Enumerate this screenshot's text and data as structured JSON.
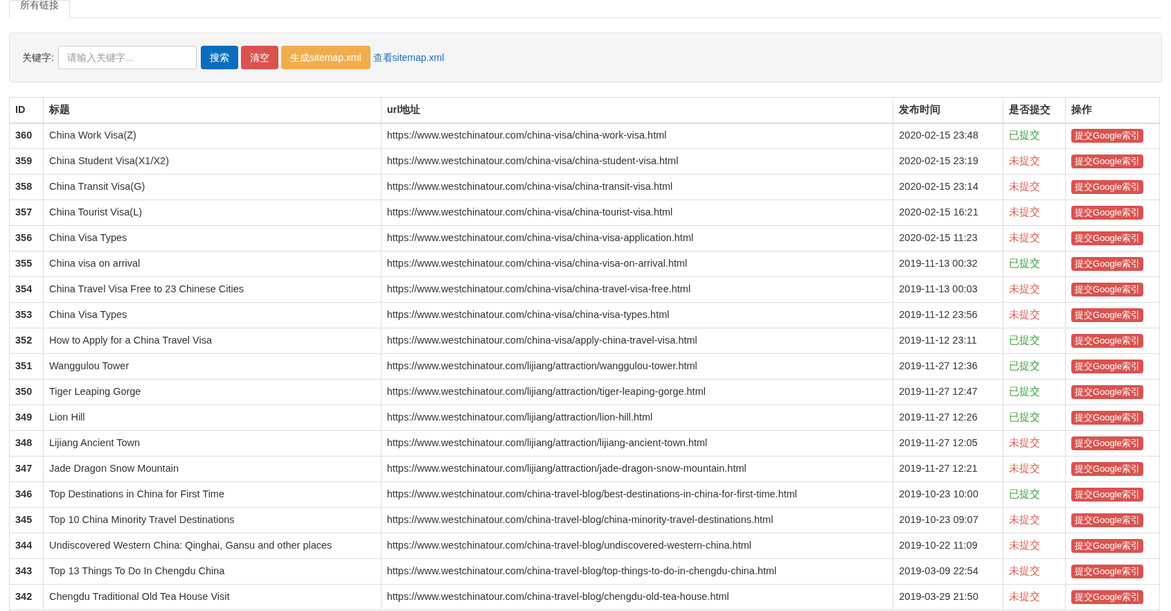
{
  "tabs": [
    {
      "label": "所有链接",
      "selected": true
    }
  ],
  "search": {
    "label": "关键字:",
    "placeholder": "请输入关键字...",
    "buttons": [
      {
        "label": "搜索",
        "kind": "primary"
      },
      {
        "label": "清空",
        "kind": "danger"
      },
      {
        "label": "生成sitemap.xml",
        "kind": "warning"
      }
    ],
    "link": "查看sitemap.xml"
  },
  "table": {
    "columns": [
      "ID",
      "标题",
      "url地址",
      "发布时间",
      "是否提交",
      "操作"
    ],
    "rows": [
      {
        "id": "360",
        "title": "China Work Visa(Z)",
        "url": "https://www.westchinatour.com/china-visa/china-work-visa.html",
        "time": "2020-02-15 23:48",
        "status": "已提交",
        "submitted": true,
        "action": "提交Google索引"
      },
      {
        "id": "359",
        "title": "China Student Visa(X1/X2)",
        "url": "https://www.westchinatour.com/china-visa/china-student-visa.html",
        "time": "2020-02-15 23:19",
        "status": "未提交",
        "submitted": false,
        "action": "提交Google索引"
      },
      {
        "id": "358",
        "title": "China Transit Visa(G)",
        "url": "https://www.westchinatour.com/china-visa/china-transit-visa.html",
        "time": "2020-02-15 23:14",
        "status": "未提交",
        "submitted": false,
        "action": "提交Google索引"
      },
      {
        "id": "357",
        "title": "China Tourist Visa(L)",
        "url": "https://www.westchinatour.com/china-visa/china-tourist-visa.html",
        "time": "2020-02-15 16:21",
        "status": "未提交",
        "submitted": false,
        "action": "提交Google索引"
      },
      {
        "id": "356",
        "title": "China Visa Types",
        "url": "https://www.westchinatour.com/china-visa/china-visa-application.html",
        "time": "2020-02-15 11:23",
        "status": "未提交",
        "submitted": false,
        "action": "提交Google索引"
      },
      {
        "id": "355",
        "title": "China visa on arrival",
        "url": "https://www.westchinatour.com/china-visa/china-visa-on-arrival.html",
        "time": "2019-11-13 00:32",
        "status": "已提交",
        "submitted": true,
        "action": "提交Google索引"
      },
      {
        "id": "354",
        "title": "China Travel Visa Free to 23 Chinese Cities",
        "url": "https://www.westchinatour.com/china-visa/china-travel-visa-free.html",
        "time": "2019-11-13 00:03",
        "status": "未提交",
        "submitted": false,
        "action": "提交Google索引"
      },
      {
        "id": "353",
        "title": "China Visa Types",
        "url": "https://www.westchinatour.com/china-visa/china-visa-types.html",
        "time": "2019-11-12 23:56",
        "status": "未提交",
        "submitted": false,
        "action": "提交Google索引"
      },
      {
        "id": "352",
        "title": "How to Apply for a China Travel Visa",
        "url": "https://www.westchinatour.com/china-visa/apply-china-travel-visa.html",
        "time": "2019-11-12 23:11",
        "status": "已提交",
        "submitted": true,
        "action": "提交Google索引"
      },
      {
        "id": "351",
        "title": "Wanggulou Tower",
        "url": "https://www.westchinatour.com/lijiang/attraction/wanggulou-tower.html",
        "time": "2019-11-27 12:36",
        "status": "已提交",
        "submitted": true,
        "action": "提交Google索引"
      },
      {
        "id": "350",
        "title": "Tiger Leaping Gorge",
        "url": "https://www.westchinatour.com/lijiang/attraction/tiger-leaping-gorge.html",
        "time": "2019-11-27 12:47",
        "status": "已提交",
        "submitted": true,
        "action": "提交Google索引"
      },
      {
        "id": "349",
        "title": "Lion Hill",
        "url": "https://www.westchinatour.com/lijiang/attraction/lion-hill.html",
        "time": "2019-11-27 12:26",
        "status": "已提交",
        "submitted": true,
        "action": "提交Google索引"
      },
      {
        "id": "348",
        "title": "Lijiang Ancient Town",
        "url": "https://www.westchinatour.com/lijiang/attraction/lijiang-ancient-town.html",
        "time": "2019-11-27 12:05",
        "status": "未提交",
        "submitted": false,
        "action": "提交Google索引"
      },
      {
        "id": "347",
        "title": "Jade Dragon Snow Mountain",
        "url": "https://www.westchinatour.com/lijiang/attraction/jade-dragon-snow-mountain.html",
        "time": "2019-11-27 12:21",
        "status": "未提交",
        "submitted": false,
        "action": "提交Google索引"
      },
      {
        "id": "346",
        "title": "Top Destinations in China for First Time",
        "url": "https://www.westchinatour.com/china-travel-blog/best-destinations-in-china-for-first-time.html",
        "time": "2019-10-23 10:00",
        "status": "已提交",
        "submitted": true,
        "action": "提交Google索引"
      },
      {
        "id": "345",
        "title": "Top 10 China Minority Travel Destinations",
        "url": "https://www.westchinatour.com/china-travel-blog/china-minority-travel-destinations.html",
        "time": "2019-10-23 09:07",
        "status": "未提交",
        "submitted": false,
        "action": "提交Google索引"
      },
      {
        "id": "344",
        "title": "Undiscovered Western China: Qinghai, Gansu and other places",
        "url": "https://www.westchinatour.com/china-travel-blog/undiscovered-western-china.html",
        "time": "2019-10-22 11:09",
        "status": "未提交",
        "submitted": false,
        "action": "提交Google索引"
      },
      {
        "id": "343",
        "title": "Top 13 Things To Do In Chengdu China",
        "url": "https://www.westchinatour.com/china-travel-blog/top-things-to-do-in-chengdu-china.html",
        "time": "2019-03-09 22:54",
        "status": "未提交",
        "submitted": false,
        "action": "提交Google索引"
      },
      {
        "id": "342",
        "title": "Chengdu Traditional Old Tea House Visit",
        "url": "https://www.westchinatour.com/china-travel-blog/chengdu-old-tea-house.html",
        "time": "2019-03-29 21:50",
        "status": "未提交",
        "submitted": false,
        "action": "提交Google索引"
      }
    ]
  }
}
